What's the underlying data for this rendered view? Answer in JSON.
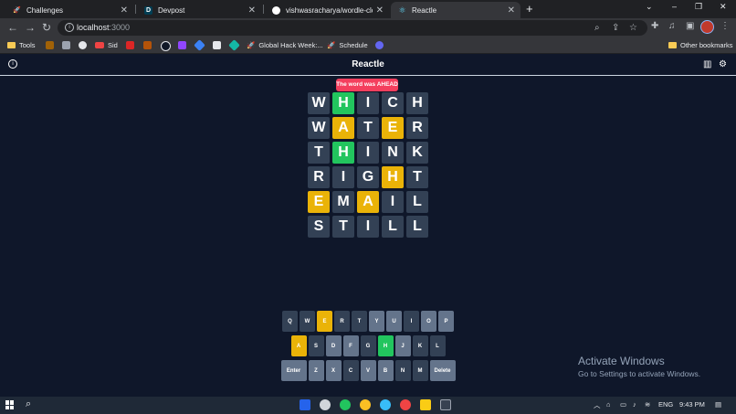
{
  "browser": {
    "tabs": [
      {
        "label": "Challenges",
        "favicon": "rocket-icon"
      },
      {
        "label": "Devpost",
        "favicon": "devpost-icon"
      },
      {
        "label": "vishwasracharya/wordle-clone-re",
        "favicon": "github-icon"
      },
      {
        "label": "Reactle",
        "favicon": "react-icon",
        "active": true
      }
    ],
    "new_tab_label": "+",
    "url_host": "localhost",
    "url_port": ":3000",
    "bookmarks": [
      {
        "label": "Tools",
        "type": "folder"
      },
      {
        "label": "Sid",
        "type": "link"
      },
      {
        "label": "Global Hack Week:...",
        "type": "link"
      },
      {
        "label": "Schedule",
        "type": "link"
      }
    ],
    "other_bookmarks": "Other bookmarks"
  },
  "app": {
    "title": "Reactle",
    "toast": "The word was AHEAD"
  },
  "board": [
    [
      [
        "W",
        "absent"
      ],
      [
        "H",
        "correct"
      ],
      [
        "I",
        "absent"
      ],
      [
        "C",
        "absent"
      ],
      [
        "H",
        "absent"
      ]
    ],
    [
      [
        "W",
        "absent"
      ],
      [
        "A",
        "present"
      ],
      [
        "T",
        "absent"
      ],
      [
        "E",
        "present"
      ],
      [
        "R",
        "absent"
      ]
    ],
    [
      [
        "T",
        "absent"
      ],
      [
        "H",
        "correct"
      ],
      [
        "I",
        "absent"
      ],
      [
        "N",
        "absent"
      ],
      [
        "K",
        "absent"
      ]
    ],
    [
      [
        "R",
        "absent"
      ],
      [
        "I",
        "absent"
      ],
      [
        "G",
        "absent"
      ],
      [
        "H",
        "present"
      ],
      [
        "T",
        "absent"
      ]
    ],
    [
      [
        "E",
        "present"
      ],
      [
        "M",
        "absent"
      ],
      [
        "A",
        "present"
      ],
      [
        "I",
        "absent"
      ],
      [
        "L",
        "absent"
      ]
    ],
    [
      [
        "S",
        "absent"
      ],
      [
        "T",
        "absent"
      ],
      [
        "I",
        "absent"
      ],
      [
        "L",
        "absent"
      ],
      [
        "L",
        "absent"
      ]
    ]
  ],
  "keyboard": [
    [
      [
        "Q",
        "absent"
      ],
      [
        "W",
        "absent"
      ],
      [
        "E",
        "present"
      ],
      [
        "R",
        "absent"
      ],
      [
        "T",
        "absent"
      ],
      [
        "Y",
        "unused"
      ],
      [
        "U",
        "unused"
      ],
      [
        "I",
        "absent"
      ],
      [
        "O",
        "unused"
      ],
      [
        "P",
        "unused"
      ]
    ],
    [
      [
        "A",
        "present"
      ],
      [
        "S",
        "absent"
      ],
      [
        "D",
        "unused"
      ],
      [
        "F",
        "unused"
      ],
      [
        "G",
        "absent"
      ],
      [
        "H",
        "correct"
      ],
      [
        "J",
        "unused"
      ],
      [
        "K",
        "absent"
      ],
      [
        "L",
        "absent"
      ]
    ],
    [
      [
        "Enter",
        "special"
      ],
      [
        "Z",
        "unused"
      ],
      [
        "X",
        "unused"
      ],
      [
        "C",
        "absent"
      ],
      [
        "V",
        "unused"
      ],
      [
        "B",
        "unused"
      ],
      [
        "N",
        "absent"
      ],
      [
        "M",
        "absent"
      ],
      [
        "Delete",
        "special"
      ]
    ]
  ],
  "watermark": {
    "line1": "Activate Windows",
    "line2": "Go to Settings to activate Windows."
  },
  "taskbar": {
    "lang": "ENG",
    "time": "9:43 PM"
  },
  "colors": {
    "background": "#0f172a",
    "correct": "#22c55e",
    "present": "#eab308",
    "absent": "#334155",
    "toast": "#f43f5e"
  }
}
